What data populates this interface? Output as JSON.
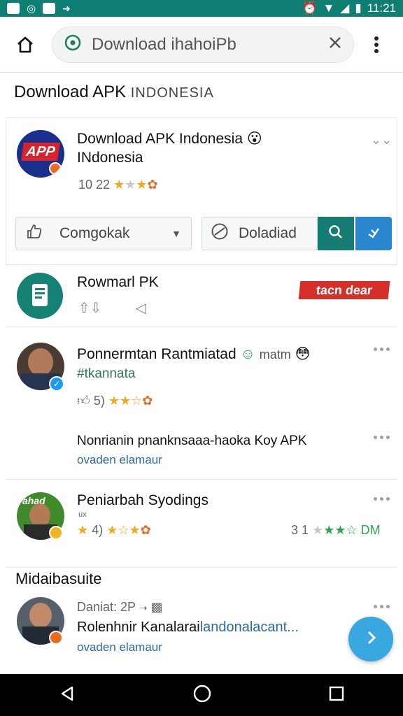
{
  "status_bar": {
    "time": "11:21",
    "icons": [
      "photo-icon",
      "whatsapp-icon",
      "message-icon",
      "arrow-icon",
      "alarm-icon",
      "wifi-icon",
      "signal-icon",
      "battery-icon"
    ]
  },
  "browser": {
    "url_text": "Download ihahoiPb",
    "home_icon": "home-icon",
    "site_icon": "lock-icon",
    "clear_icon": "close-icon",
    "menu_icon": "more-vert-icon"
  },
  "page": {
    "title_main": "Download APK",
    "title_sub": "INDONESIA"
  },
  "app_card": {
    "name": "Download APK Indonesia",
    "publisher": "INdonesia",
    "meta_number": "10 22",
    "logo_text": "APP",
    "left_button_label": "Comgokak",
    "right_button_label": "Doladiad",
    "accent_teal": "#167c73",
    "accent_blue": "#2b86d0"
  },
  "promo_row": {
    "title": "Rowmarl PK",
    "badge_text": "tacn dear"
  },
  "review_1": {
    "name": "Ponnermtan Rantmiatad",
    "emoji_text": "matm",
    "handle": "#tkannata",
    "count": "5)",
    "comment": "Nonrianin pnanknsaaa-haoka Koy APK",
    "reply_link": "ovaden elamaur"
  },
  "review_2": {
    "name": "Peniarbah Syodings",
    "avatar_tag": "ahad",
    "small_label": "ux",
    "rating_left": "4)",
    "rating_right_number": "3 1",
    "rating_right_suffix": "DM"
  },
  "section": {
    "label": "Midaibasuite"
  },
  "review_3": {
    "meta": "Daniat: 2P",
    "text_dark": "Rolenhnir Kanalarai",
    "text_blue": "landonalacant...",
    "reply_link": "ovaden elamaur"
  },
  "nav": {
    "back_icon": "back-icon",
    "home_icon": "home-circle-icon",
    "recents_icon": "recents-icon"
  }
}
